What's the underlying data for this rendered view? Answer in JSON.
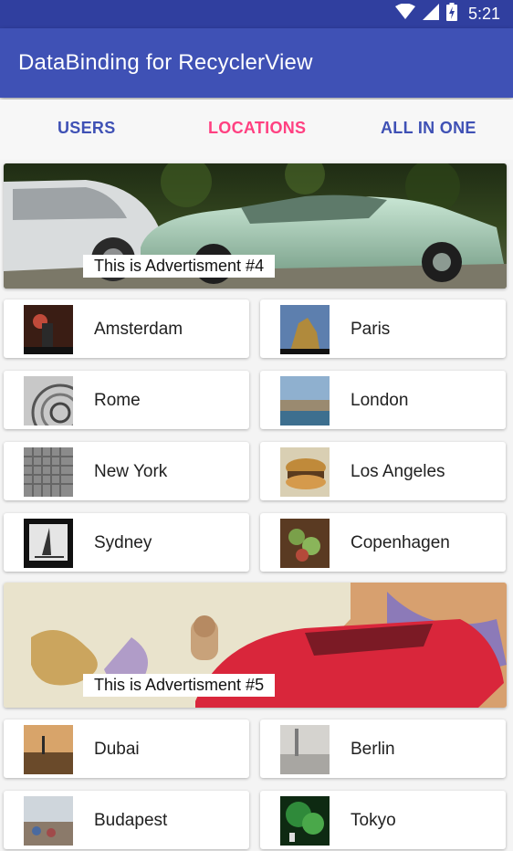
{
  "status_bar": {
    "time": "5:21",
    "icons": [
      "wifi-icon",
      "signal-icon",
      "battery-charging-icon"
    ],
    "color": "#303f9f"
  },
  "app_bar": {
    "title": "DataBinding for RecyclerView",
    "color": "#3f51b5"
  },
  "tabs": [
    {
      "label": "USERS",
      "active": false
    },
    {
      "label": "LOCATIONS",
      "active": true
    },
    {
      "label": "ALL IN ONE",
      "active": false
    }
  ],
  "accent_color": "#ff4081",
  "feed": {
    "ads": [
      {
        "caption": "This is Advertisment #4"
      },
      {
        "caption": "This is Advertisment #5"
      }
    ],
    "locations": [
      {
        "name": "Amsterdam"
      },
      {
        "name": "Paris"
      },
      {
        "name": "Rome"
      },
      {
        "name": "London"
      },
      {
        "name": "New York"
      },
      {
        "name": "Los Angeles"
      },
      {
        "name": "Sydney"
      },
      {
        "name": "Copenhagen"
      },
      {
        "name": "Dubai"
      },
      {
        "name": "Berlin"
      },
      {
        "name": "Budapest"
      },
      {
        "name": "Tokyo"
      }
    ]
  }
}
